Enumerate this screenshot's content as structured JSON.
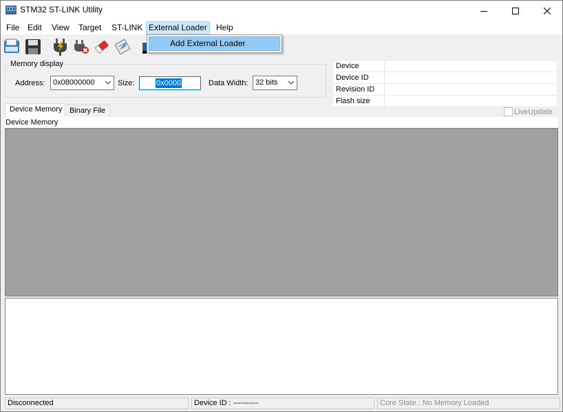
{
  "window": {
    "title": "STM32 ST-LINK Utility"
  },
  "menu": {
    "items": [
      "File",
      "Edit",
      "View",
      "Target",
      "ST-LINK",
      "External Loader",
      "Help"
    ],
    "open_menu": {
      "name": "External Loader",
      "items": [
        "Add External Loader"
      ]
    }
  },
  "toolbar": {
    "buttons": [
      {
        "icon": "open-file-icon"
      },
      {
        "icon": "save-icon"
      },
      {
        "icon": "connect-icon"
      },
      {
        "icon": "disconnect-icon"
      },
      {
        "icon": "erase-chip-icon"
      },
      {
        "icon": "program-icon"
      },
      {
        "icon": "device-icon"
      }
    ]
  },
  "memory_display": {
    "group_label": "Memory display",
    "address_label": "Address:",
    "address_value": "0x08000000",
    "size_label": "Size:",
    "size_value": "0x0000",
    "data_width_label": "Data Width:",
    "data_width_value": "32 bits"
  },
  "device_info": {
    "rows": [
      {
        "key": "Device",
        "value": ""
      },
      {
        "key": "Device ID",
        "value": ""
      },
      {
        "key": "Revision ID",
        "value": ""
      },
      {
        "key": "Flash size",
        "value": ""
      }
    ]
  },
  "tabs": [
    "Device Memory",
    "Binary File"
  ],
  "live_update": {
    "label": "LiveUpdate",
    "checked": false
  },
  "panel": {
    "title": "Device Memory"
  },
  "status_bar": {
    "connection": "Disconnected",
    "device_id": "Device ID : ----------",
    "core_state": "Core State : No Memory Loaded"
  },
  "colors": {
    "menu_highlight": "#cce8ff",
    "dropdown_highlight": "#91c9f7",
    "memory_area": "#a0a0a0",
    "selection": "#0078d7"
  }
}
